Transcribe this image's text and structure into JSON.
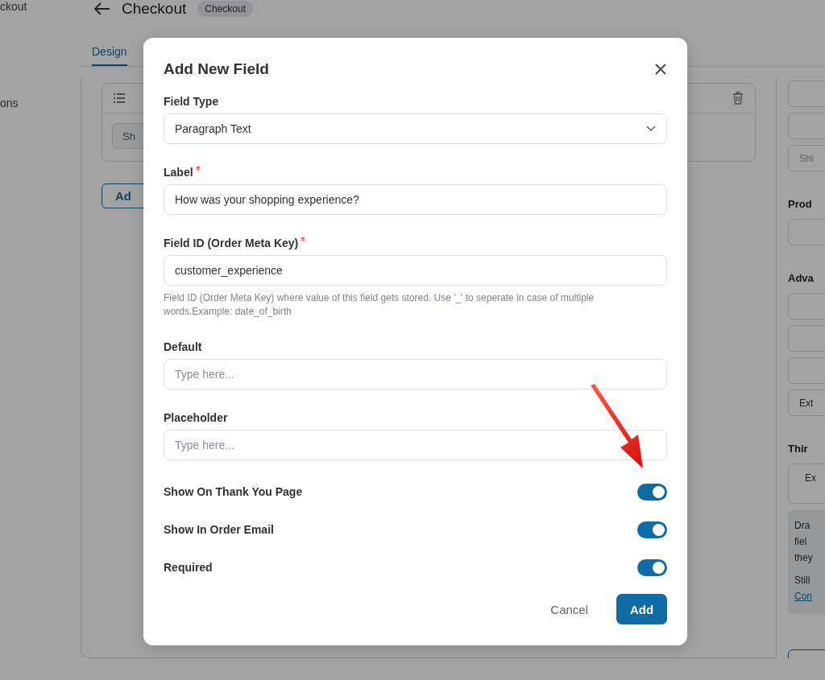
{
  "background": {
    "sidebar": [
      {
        "label": "ckout"
      },
      {
        "label": "ons"
      }
    ],
    "header": {
      "title": "Checkout",
      "badge": "Checkout"
    },
    "tabs": [
      {
        "label": "Design",
        "selected": true
      }
    ],
    "card": {
      "chip": "Sh",
      "button": "Ad"
    },
    "right_panel": [
      {
        "kind": "field"
      },
      {
        "kind": "field"
      },
      {
        "kind": "field",
        "placeholder": "Shi"
      },
      {
        "kind": "heading",
        "text": "Prod"
      },
      {
        "kind": "field"
      },
      {
        "kind": "heading",
        "text": "Adva"
      },
      {
        "kind": "field"
      },
      {
        "kind": "field"
      },
      {
        "kind": "field"
      },
      {
        "kind": "field",
        "value": "Ext"
      },
      {
        "kind": "heading",
        "text": "Thir"
      },
      {
        "kind": "select",
        "value": "Ex"
      },
      {
        "kind": "info",
        "lines": [
          "Dra",
          "fiel",
          "they"
        ],
        "note": "Still",
        "link": "Con"
      },
      {
        "kind": "button"
      }
    ]
  },
  "modal": {
    "title": "Add New Field",
    "fields": [
      {
        "kind": "select",
        "label": "Field Type",
        "required": false,
        "value": "Paragraph Text"
      },
      {
        "kind": "text",
        "label": "Label",
        "required": true,
        "value": "How was your shopping experience?"
      },
      {
        "kind": "text",
        "label": "Field ID (Order Meta Key)",
        "required": true,
        "value": "customer_experience",
        "help": "Field ID (Order Meta Key) where value of this field gets stored. Use '_' to seperate in case of multiple words.Example: date_of_birth"
      },
      {
        "kind": "text",
        "label": "Default",
        "required": false,
        "placeholder": "Type here..."
      },
      {
        "kind": "text",
        "label": "Placeholder",
        "required": false,
        "placeholder": "Type here..."
      }
    ],
    "toggles": [
      {
        "label": "Show On Thank You Page",
        "on": true
      },
      {
        "label": "Show In Order Email",
        "on": true
      },
      {
        "label": "Required",
        "on": true
      }
    ],
    "buttons": [
      {
        "kind": "secondary",
        "label": "Cancel"
      },
      {
        "kind": "primary",
        "label": "Add"
      }
    ]
  }
}
